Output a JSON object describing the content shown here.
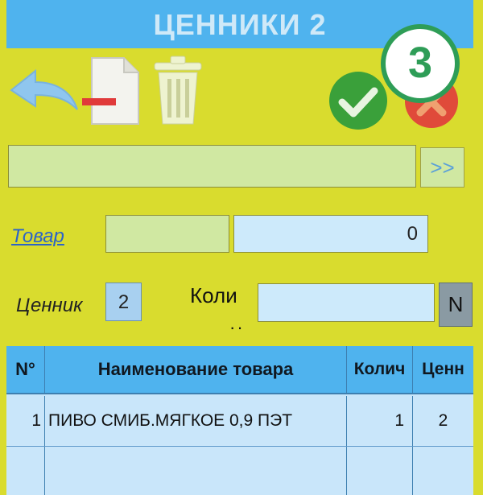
{
  "header": {
    "title": "ЦЕННИКИ 2"
  },
  "badge": {
    "text": "3"
  },
  "toolbar": {
    "icons": [
      "back-arrow-icon",
      "remove-document-icon",
      "trash-icon",
      "confirm-check-icon",
      "cancel-icon"
    ]
  },
  "search": {
    "arrow_label": ">>",
    "value": ""
  },
  "product": {
    "label": "Товар",
    "code_value": "",
    "amount_value": "0"
  },
  "tag": {
    "label": "Ценник",
    "value": "2",
    "qty_label": "Коли",
    "qty_value": "",
    "n_label": "N"
  },
  "table": {
    "columns": [
      "N°",
      "Наименование товара",
      "Колич",
      "Ценн"
    ],
    "rows": [
      {
        "no": "1",
        "name": "ПИВО СМИБ.МЯГКОЕ 0,9 ПЭТ",
        "qty": "1",
        "tag": "2"
      }
    ]
  },
  "colors": {
    "background": "#d9dc2e",
    "header": "#4fb3ee",
    "badge_green": "#2e9d57",
    "confirm_green": "#3aa03a",
    "cancel_red": "#e04a3a"
  }
}
